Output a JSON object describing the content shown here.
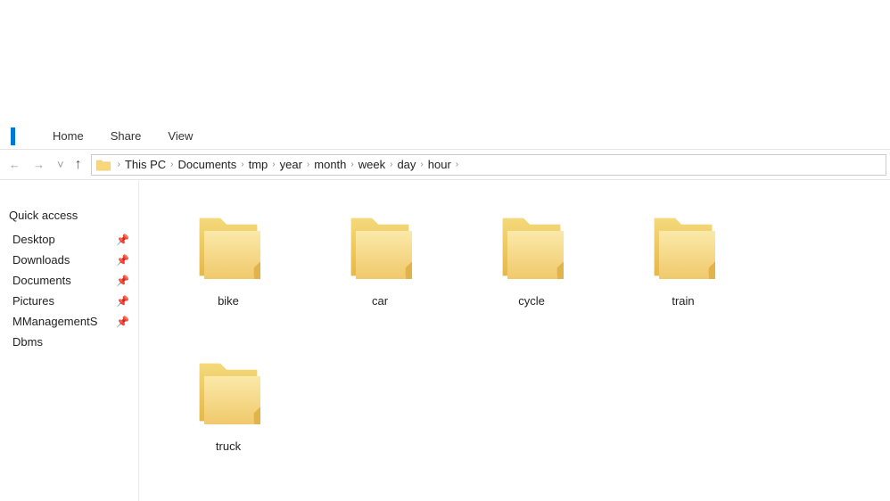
{
  "ribbon": {
    "tabs": [
      "Home",
      "Share",
      "View"
    ]
  },
  "breadcrumb": {
    "items": [
      "This PC",
      "Documents",
      "tmp",
      "year",
      "month",
      "week",
      "day",
      "hour"
    ]
  },
  "sidebar": {
    "header": "Quick access",
    "items": [
      {
        "label": "Desktop",
        "pinned": true
      },
      {
        "label": "Downloads",
        "pinned": true
      },
      {
        "label": "Documents",
        "pinned": true
      },
      {
        "label": "Pictures",
        "pinned": true
      },
      {
        "label": "MManagementS",
        "pinned": true
      },
      {
        "label": "Dbms",
        "pinned": false
      }
    ]
  },
  "folders": [
    {
      "name": "bike"
    },
    {
      "name": "car"
    },
    {
      "name": "cycle"
    },
    {
      "name": "train"
    },
    {
      "name": "truck"
    }
  ]
}
